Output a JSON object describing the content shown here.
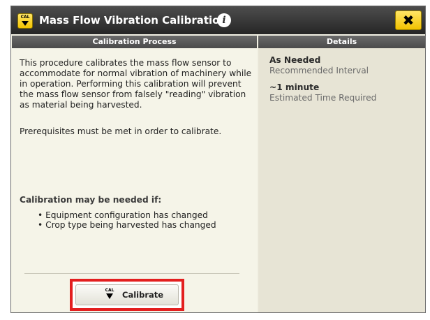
{
  "window": {
    "title": "Mass Flow Vibration Calibration",
    "title_icon_text": "CAL",
    "info_glyph": "i",
    "close_glyph": "✖"
  },
  "calibration_process": {
    "header": "Calibration Process",
    "description": "This procedure calibrates the mass flow sensor to accommodate for normal vibration of machinery while in operation. Performing this calibration will prevent the mass flow sensor from falsely \"reading\" vibration as material being harvested.",
    "prerequisites": "Prerequisites must be met in order to calibrate.",
    "needed_title": "Calibration may be needed if:",
    "needed_items": [
      "Equipment configuration has changed",
      "Crop type being harvested has changed"
    ],
    "calibrate_button": {
      "icon_text": "CAL",
      "label": "Calibrate"
    }
  },
  "details": {
    "header": "Details",
    "items": [
      {
        "value": "As Needed",
        "label": "Recommended Interval"
      },
      {
        "value": "~1 minute",
        "label": "Estimated Time Required"
      }
    ]
  },
  "colors": {
    "accent_yellow": "#f4c400",
    "highlight_red": "#e31f1f",
    "titlebar": "#333333"
  }
}
